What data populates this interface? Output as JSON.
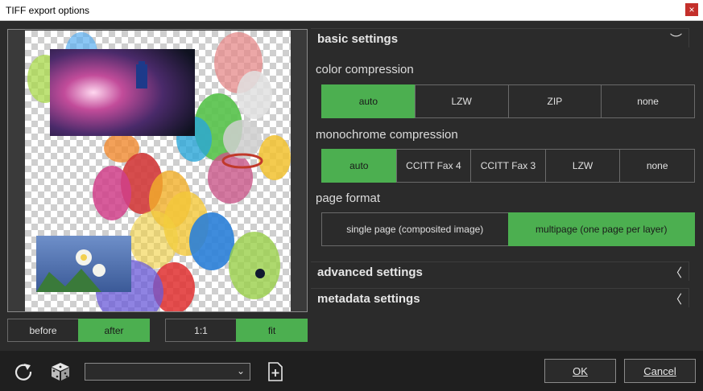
{
  "window": {
    "title": "TIFF export options",
    "close_glyph": "×"
  },
  "preview": {
    "toggle_before": "before",
    "toggle_after": "after",
    "toggle_selected": "after",
    "zoom_1to1": "1:1",
    "zoom_fit": "fit",
    "zoom_selected": "fit"
  },
  "sections": {
    "basic": {
      "label": "basic settings",
      "state": "expanded"
    },
    "advanced": {
      "label": "advanced settings",
      "state": "collapsed"
    },
    "metadata": {
      "label": "metadata settings",
      "state": "collapsed"
    }
  },
  "color_compression": {
    "label": "color compression",
    "options": [
      "auto",
      "LZW",
      "ZIP",
      "none"
    ],
    "selected": "auto"
  },
  "mono_compression": {
    "label": "monochrome compression",
    "options": [
      "auto",
      "CCITT Fax 4",
      "CCITT Fax 3",
      "LZW",
      "none"
    ],
    "selected": "auto"
  },
  "page_format": {
    "label": "page format",
    "options": [
      "single page (composited image)",
      "multipage (one page per layer)"
    ],
    "selected": "multipage (one page per layer)"
  },
  "bottom": {
    "preset_value": "",
    "ok_label": "OK",
    "cancel_label": "Cancel"
  },
  "icons": {
    "reset": "reset-icon",
    "random": "dice-icon",
    "add_preset": "add-file-icon"
  },
  "colors": {
    "accent": "#4caf50",
    "background": "#2b2b2b",
    "bottom_bar": "#1f1f1f"
  }
}
